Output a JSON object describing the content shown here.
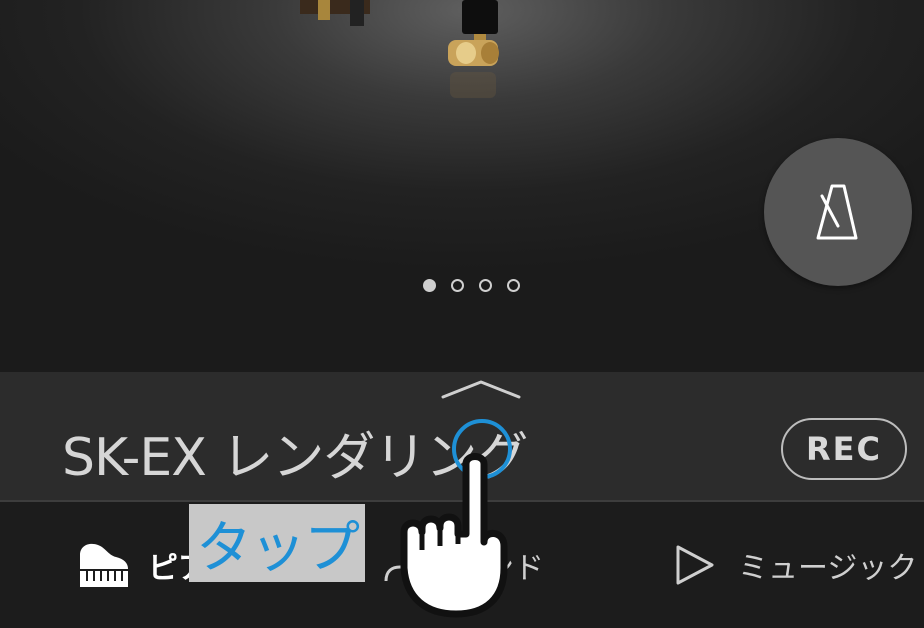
{
  "hero": {
    "carousel_pages": 4,
    "carousel_active_index": 0,
    "metronome_icon": "metronome-icon"
  },
  "title_bar": {
    "expand_icon": "chevron-up-icon",
    "sound_name": "SK-EX レンダリング",
    "rec_label": "REC"
  },
  "tabs": [
    {
      "label": "ピアノ",
      "icon": "grand-piano-icon",
      "active": true
    },
    {
      "label": "サウンド",
      "icon": "sound-icon",
      "active": false
    },
    {
      "label": "ミュージック",
      "icon": "play-icon",
      "active": false
    }
  ],
  "callout": {
    "label": "タップ",
    "accent_color": "#1e90d6",
    "icon": "pointing-hand-icon"
  }
}
